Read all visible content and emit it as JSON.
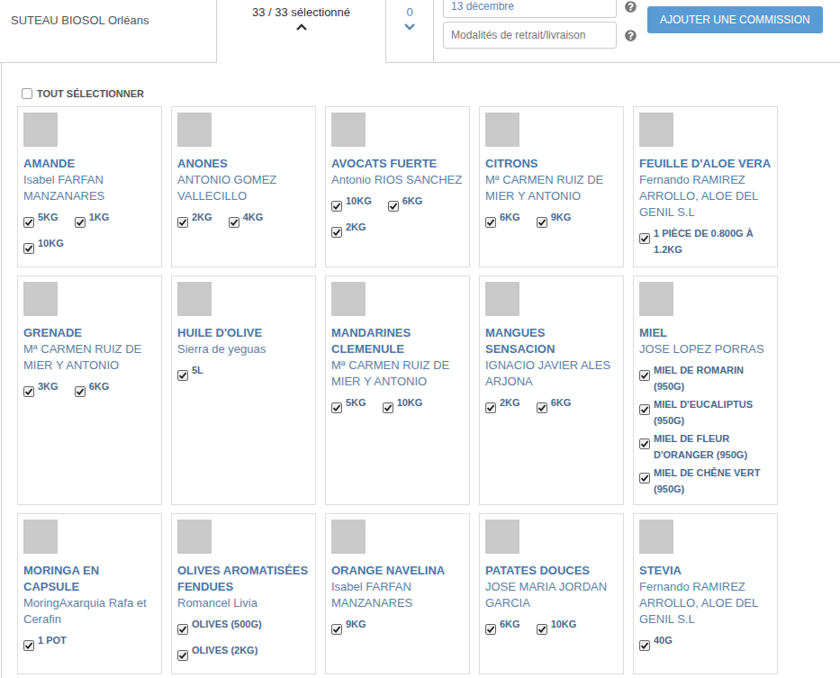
{
  "toolbar": {
    "shop": "SUTEAU BIOSOL Orléans",
    "selection": {
      "label": "33 / 33 sélectionné",
      "selected": true,
      "expanded": true
    },
    "count": {
      "label": "0",
      "expanded": false
    },
    "date_field": {
      "value": "13 décembre"
    },
    "delivery_field": {
      "placeholder": "Modalités de retrait/livraison"
    },
    "button": "AJOUTER UNE COMMISSION"
  },
  "select_all": {
    "label": "TOUT SÉLECTIONNER",
    "checked": false
  },
  "products": [
    {
      "name": "AMANDE",
      "producer": "Isabel FARFAN MANZANARES",
      "options": [
        {
          "label": "5KG",
          "checked": true
        },
        {
          "label": "1KG",
          "checked": true
        },
        {
          "label": "10KG",
          "checked": true
        }
      ]
    },
    {
      "name": "ANONES",
      "producer": "ANTONIO GOMEZ VALLECILLO",
      "options": [
        {
          "label": "2KG",
          "checked": true
        },
        {
          "label": "4KG",
          "checked": true
        }
      ]
    },
    {
      "name": "AVOCATS FUERTE",
      "producer": "Antonio RIOS SANCHEZ",
      "options": [
        {
          "label": "10KG",
          "checked": true
        },
        {
          "label": "6KG",
          "checked": true
        },
        {
          "label": "2KG",
          "checked": true
        }
      ]
    },
    {
      "name": "CITRONS",
      "producer": "Mª CARMEN RUIZ DE MIER Y ANTONIO",
      "options": [
        {
          "label": "6KG",
          "checked": true
        },
        {
          "label": "9KG",
          "checked": true
        }
      ]
    },
    {
      "name": "FEUILLE D'ALOE VERA",
      "producer": "Fernando RAMIREZ ARROLLO, ALOE DEL GENIL S.L",
      "options": [
        {
          "label": "1 PIÈCE DE 0.800G À 1.2KG",
          "checked": true
        }
      ]
    },
    {
      "name": "GRENADE",
      "producer": "Mª CARMEN RUIZ DE MIER Y ANTONIO",
      "options": [
        {
          "label": "3KG",
          "checked": true
        },
        {
          "label": "6KG",
          "checked": true
        }
      ]
    },
    {
      "name": "HUILE D'OLIVE",
      "producer": "Sierra de yeguas",
      "options": [
        {
          "label": "5L",
          "checked": true
        }
      ]
    },
    {
      "name": "MANDARINES CLEMENULE",
      "producer": "Mª CARMEN RUIZ DE MIER Y ANTONIO",
      "options": [
        {
          "label": "5KG",
          "checked": true
        },
        {
          "label": "10KG",
          "checked": true
        }
      ]
    },
    {
      "name": "MANGUES SENSACION",
      "producer": "IGNACIO JAVIER ALES ARJONA",
      "options": [
        {
          "label": "2KG",
          "checked": true
        },
        {
          "label": "6KG",
          "checked": true
        }
      ]
    },
    {
      "name": "MIEL",
      "producer": "JOSE LOPEZ PORRAS",
      "options": [
        {
          "label": "MIEL DE ROMARIN (950G)",
          "checked": true
        },
        {
          "label": "MIEL D'EUCALIPTUS (950G)",
          "checked": true
        },
        {
          "label": "MIEL DE FLEUR D'ORANGER (950G)",
          "checked": true
        },
        {
          "label": "MIEL DE CHÊNE VERT (950G)",
          "checked": true
        }
      ]
    },
    {
      "name": "MORINGA EN CAPSULE",
      "producer": "MoringAxarquia Rafa et Cerafin",
      "options": [
        {
          "label": "1 POT",
          "checked": true
        }
      ]
    },
    {
      "name": "OLIVES AROMATISÉES FENDUES",
      "producer": "Romancel Livia",
      "options": [
        {
          "label": "OLIVES (500G)",
          "checked": true
        },
        {
          "label": "OLIVES (2KG)",
          "checked": true
        }
      ]
    },
    {
      "name": "ORANGE NAVELINA",
      "producer": "Isabel FARFAN MANZANARES",
      "options": [
        {
          "label": "9KG",
          "checked": true
        }
      ]
    },
    {
      "name": "PATATES DOUCES",
      "producer": "JOSE MARIA JORDAN GARCIA",
      "options": [
        {
          "label": "6KG",
          "checked": true
        },
        {
          "label": "10KG",
          "checked": true
        }
      ]
    },
    {
      "name": "STEVIA",
      "producer": "Fernando RAMIREZ ARROLLO, ALOE DEL GENIL S.L",
      "options": [
        {
          "label": "40G",
          "checked": true
        }
      ]
    }
  ]
}
